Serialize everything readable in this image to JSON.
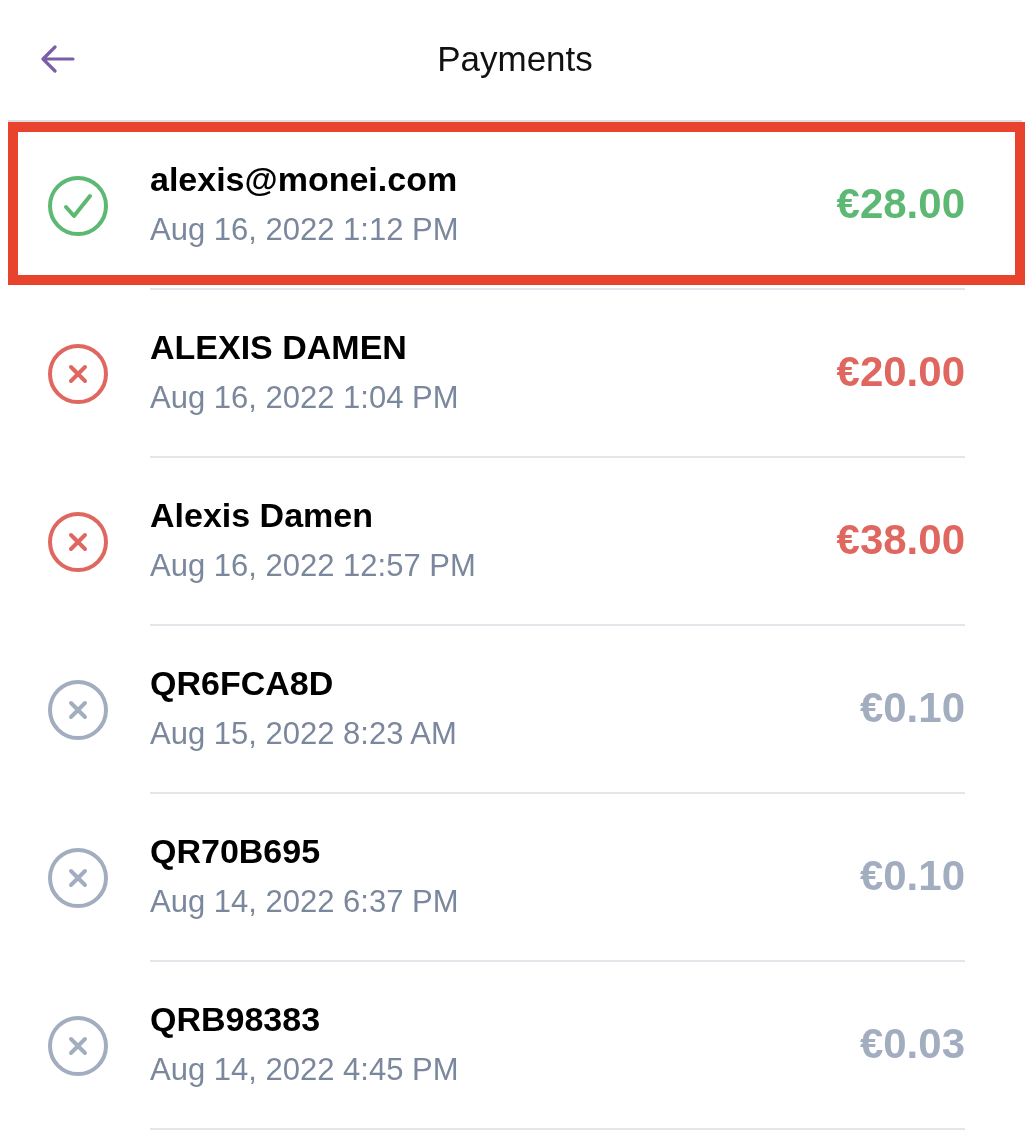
{
  "header": {
    "title": "Payments"
  },
  "rows": [
    {
      "name": "alexis@monei.com",
      "date": "Aug 16, 2022 1:12 PM",
      "amount": "€28.00",
      "kind": "check",
      "color": "#5db873",
      "highlighted": true
    },
    {
      "name": "ALEXIS DAMEN",
      "date": "Aug 16, 2022 1:04 PM",
      "amount": "€20.00",
      "kind": "cross",
      "color": "#e0675f",
      "highlighted": false
    },
    {
      "name": "Alexis Damen",
      "date": "Aug 16, 2022 12:57 PM",
      "amount": "€38.00",
      "kind": "cross",
      "color": "#e0675f",
      "highlighted": false
    },
    {
      "name": "QR6FCA8D",
      "date": "Aug 15, 2022 8:23 AM",
      "amount": "€0.10",
      "kind": "cross",
      "color": "#a2aec0",
      "highlighted": false
    },
    {
      "name": "QR70B695",
      "date": "Aug 14, 2022 6:37 PM",
      "amount": "€0.10",
      "kind": "cross",
      "color": "#a2aec0",
      "highlighted": false
    },
    {
      "name": "QRB98383",
      "date": "Aug 14, 2022 4:45 PM",
      "amount": "€0.03",
      "kind": "cross",
      "color": "#a2aec0",
      "highlighted": false
    }
  ]
}
